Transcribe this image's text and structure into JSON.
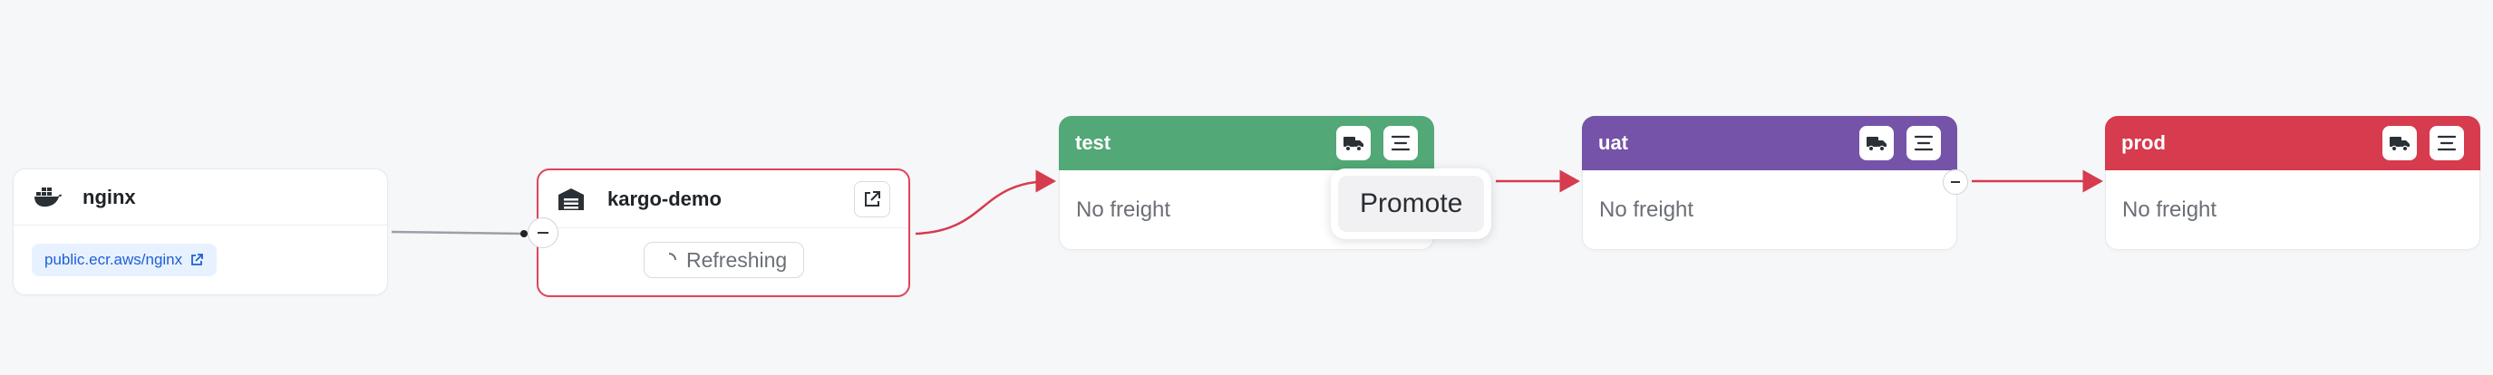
{
  "colors": {
    "test": "#52a876",
    "uat": "#7553a8",
    "prod": "#d63b4e",
    "warehouse_border": "#e04358",
    "edge_red": "#d63b4e",
    "edge_gray": "#9aa0a8"
  },
  "image_node": {
    "title": "nginx",
    "icon": "docker-icon",
    "repo_url": "public.ecr.aws/nginx"
  },
  "warehouse_node": {
    "title": "kargo-demo",
    "icon": "warehouse-icon",
    "status": "Refreshing"
  },
  "stages": [
    {
      "name": "test",
      "body": "No freight"
    },
    {
      "name": "uat",
      "body": "No freight"
    },
    {
      "name": "prod",
      "body": "No freight"
    }
  ],
  "tooltip": {
    "label": "Promote"
  }
}
